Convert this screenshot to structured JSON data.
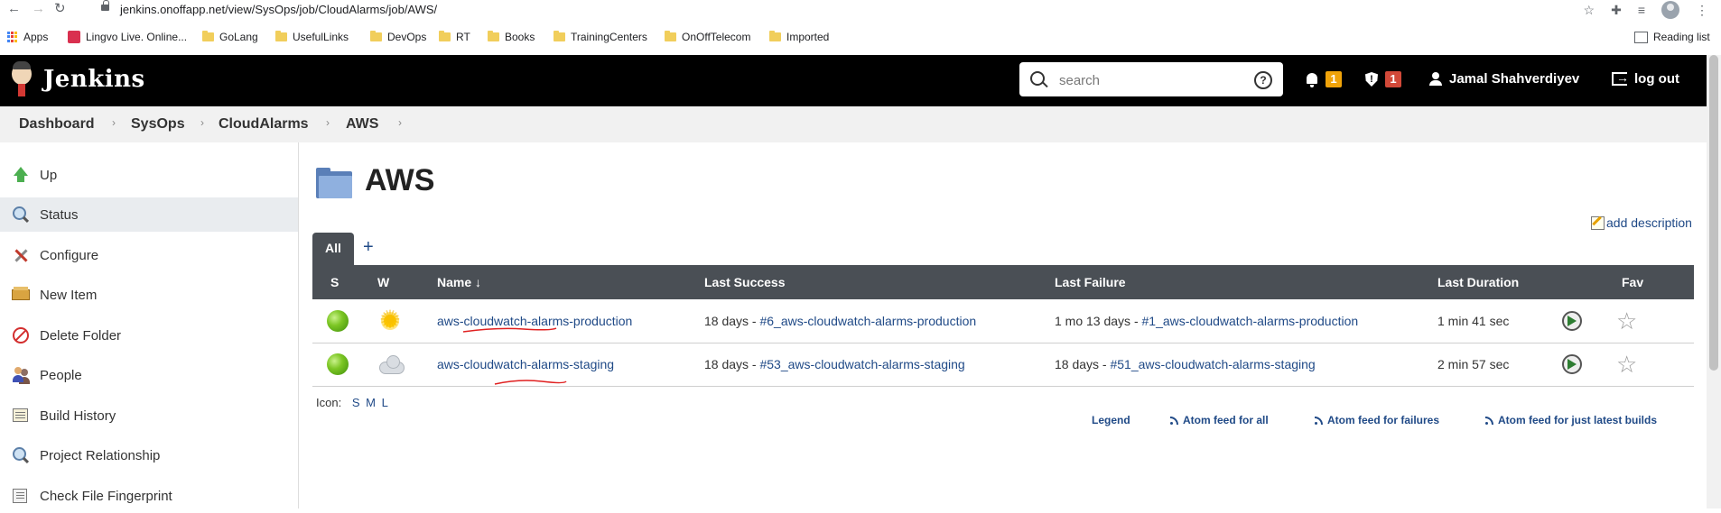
{
  "browser": {
    "url": "jenkins.onoffapp.net/view/SysOps/job/CloudAlarms/job/AWS/",
    "bookmarks": [
      "Apps",
      "Lingvo Live. Online...",
      "GoLang",
      "UsefulLinks",
      "DevOps",
      "RT",
      "Books",
      "TrainingCenters",
      "OnOffTelecom",
      "Imported"
    ],
    "reading_list": "Reading list"
  },
  "header": {
    "title": "Jenkins",
    "search_placeholder": "search",
    "help_glyph": "?",
    "notifications_count": "1",
    "security_count": "1",
    "user_name": "Jamal Shahverdiyev",
    "logout_label": "log out",
    "colors": {
      "notification_badge": "#f0a30a",
      "security_badge": "#d24939"
    }
  },
  "breadcrumb": [
    "Dashboard",
    "SysOps",
    "CloudAlarms",
    "AWS"
  ],
  "sidebar": {
    "items": [
      {
        "label": "Up",
        "icon": "up-arrow-icon"
      },
      {
        "label": "Status",
        "icon": "magnifier-icon",
        "active": true
      },
      {
        "label": "Configure",
        "icon": "tools-icon"
      },
      {
        "label": "New Item",
        "icon": "box-icon"
      },
      {
        "label": "Delete Folder",
        "icon": "no-entry-icon"
      },
      {
        "label": "People",
        "icon": "people-icon"
      },
      {
        "label": "Build History",
        "icon": "notebook-icon"
      },
      {
        "label": "Project Relationship",
        "icon": "magnifier-icon"
      },
      {
        "label": "Check File Fingerprint",
        "icon": "fingerprint-icon"
      }
    ]
  },
  "main": {
    "title": "AWS",
    "add_description": "add description",
    "tabs": {
      "all": "All",
      "add": "+"
    },
    "table": {
      "headers": {
        "s": "S",
        "w": "W",
        "name": "Name ↓",
        "last_success": "Last Success",
        "last_failure": "Last Failure",
        "last_duration": "Last Duration",
        "fav": "Fav"
      },
      "rows": [
        {
          "status": "success",
          "weather": "sunny",
          "name": "aws-cloudwatch-alarms-production",
          "last_success_age": "18 days - ",
          "last_success_build": "#6_aws-cloudwatch-alarms-production",
          "last_failure_age": "1 mo 13 days - ",
          "last_failure_build": "#1_aws-cloudwatch-alarms-production",
          "last_duration": "1 min 41 sec"
        },
        {
          "status": "success",
          "weather": "cloudy",
          "name": "aws-cloudwatch-alarms-staging",
          "last_success_age": "18 days - ",
          "last_success_build": "#53_aws-cloudwatch-alarms-staging",
          "last_failure_age": "18 days - ",
          "last_failure_build": "#51_aws-cloudwatch-alarms-staging",
          "last_duration": "2 min 57 sec"
        }
      ]
    },
    "icon_size": {
      "label": "Icon:",
      "s": "S",
      "m": "M",
      "l": "L"
    },
    "footer_links": {
      "legend": "Legend",
      "atom_all": "Atom feed for all",
      "atom_failures": "Atom feed for failures",
      "atom_latest": "Atom feed for just latest builds"
    }
  }
}
